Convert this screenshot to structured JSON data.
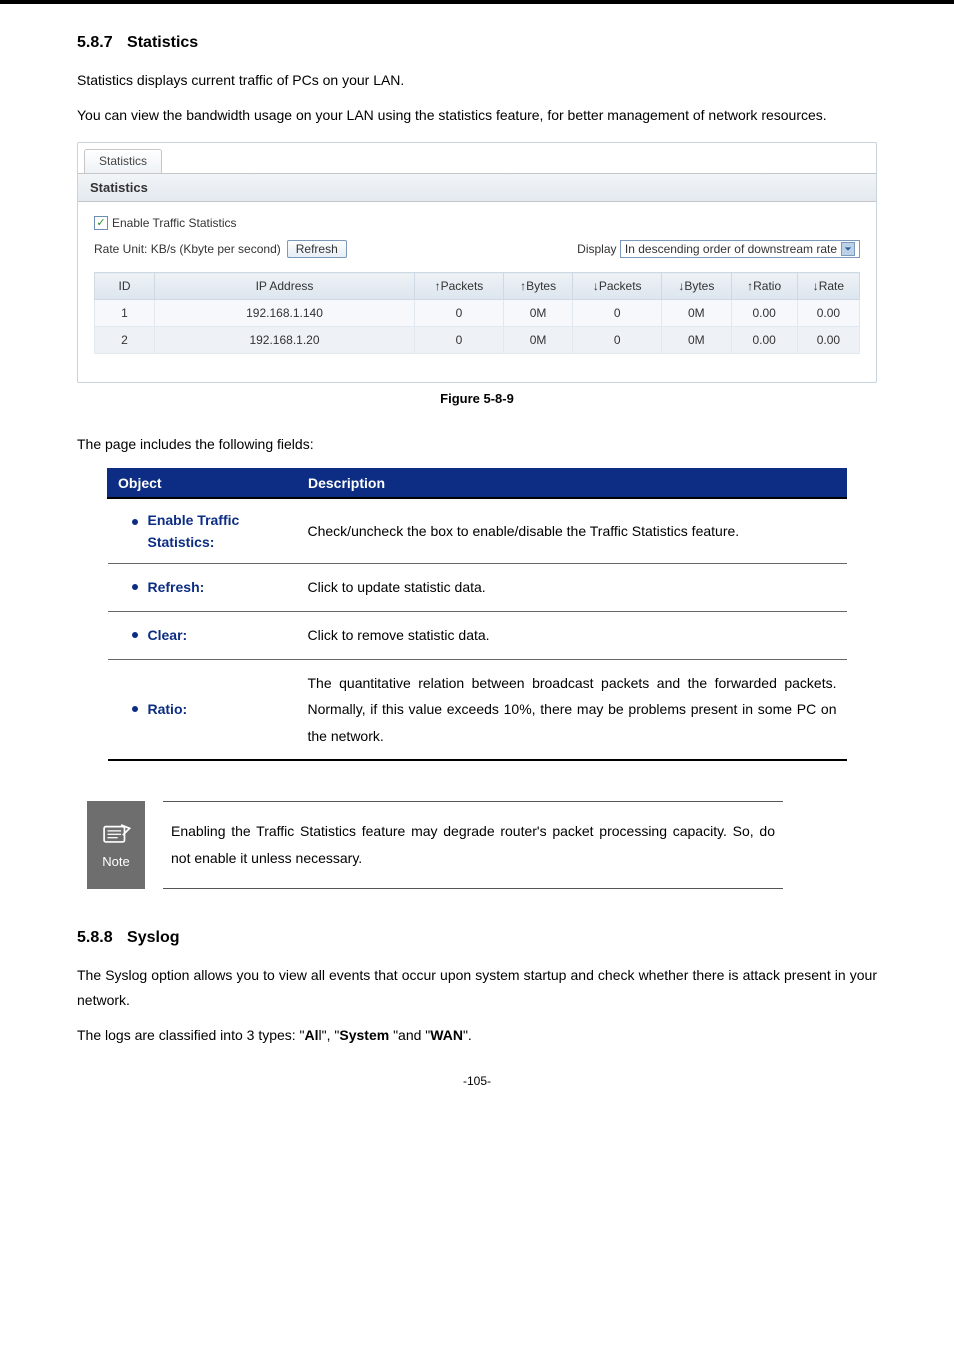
{
  "section1": {
    "number": "5.8.7",
    "title": "Statistics"
  },
  "intro1": "Statistics displays current traffic of PCs on your LAN.",
  "intro2": "You can view the bandwidth usage on your LAN using the statistics feature, for better management of network resources.",
  "shot": {
    "tab": "Statistics",
    "panel_title": "Statistics",
    "enable_label": "Enable Traffic Statistics",
    "rate_label": "Rate Unit: KB/s (Kbyte per second)",
    "refresh_btn": "Refresh",
    "display_label": "Display",
    "display_value": "In descending order of downstream rate",
    "cols": {
      "id": "ID",
      "ip": "IP Address",
      "up_pkts": "↑Packets",
      "up_bytes": "↑Bytes",
      "dn_pkts": "↓Packets",
      "dn_bytes": "↓Bytes",
      "up_ratio": "↑Ratio",
      "dn_rate": "↓Rate"
    },
    "rows": [
      {
        "id": "1",
        "ip": "192.168.1.140",
        "up_pkts": "0",
        "up_bytes": "0M",
        "dn_pkts": "0",
        "dn_bytes": "0M",
        "up_ratio": "0.00",
        "dn_rate": "0.00"
      },
      {
        "id": "2",
        "ip": "192.168.1.20",
        "up_pkts": "0",
        "up_bytes": "0M",
        "dn_pkts": "0",
        "dn_bytes": "0M",
        "up_ratio": "0.00",
        "dn_rate": "0.00"
      }
    ]
  },
  "figcap": "Figure 5-8-9",
  "fields_intro": "The page includes the following fields:",
  "obj_table": {
    "headers": {
      "object": "Object",
      "description": "Description"
    },
    "rows": [
      {
        "name_l1": "Enable Traffic",
        "name_l2": "Statistics:",
        "desc": "Check/uncheck the box to enable/disable the Traffic Statistics feature."
      },
      {
        "name_l1": "Refresh:",
        "desc": "Click to update statistic data."
      },
      {
        "name_l1": "Clear:",
        "desc": "Click to remove statistic data."
      },
      {
        "name_l1": "Ratio:",
        "desc": "The quantitative relation between broadcast packets and the forwarded packets. Normally, if this value exceeds 10%, there may be problems present in some PC on the network."
      }
    ]
  },
  "note": {
    "label": "Note",
    "text": "Enabling the Traffic Statistics feature may degrade router's packet processing capacity. So, do not enable it unless necessary."
  },
  "section2": {
    "number": "5.8.8",
    "title": "Syslog"
  },
  "syslog_p1": "The Syslog option allows you to view all events that occur upon system startup and check whether there is attack present in your network.",
  "syslog_p2_pre": "The logs are classified into 3 types: \"",
  "syslog_p2_b1": "Al",
  "syslog_p2_mid1": "l\", \"",
  "syslog_p2_b2": "System",
  "syslog_p2_mid2": " \"and \"",
  "syslog_p2_b3": "WAN",
  "syslog_p2_post": "\".",
  "pageno": "-105-"
}
